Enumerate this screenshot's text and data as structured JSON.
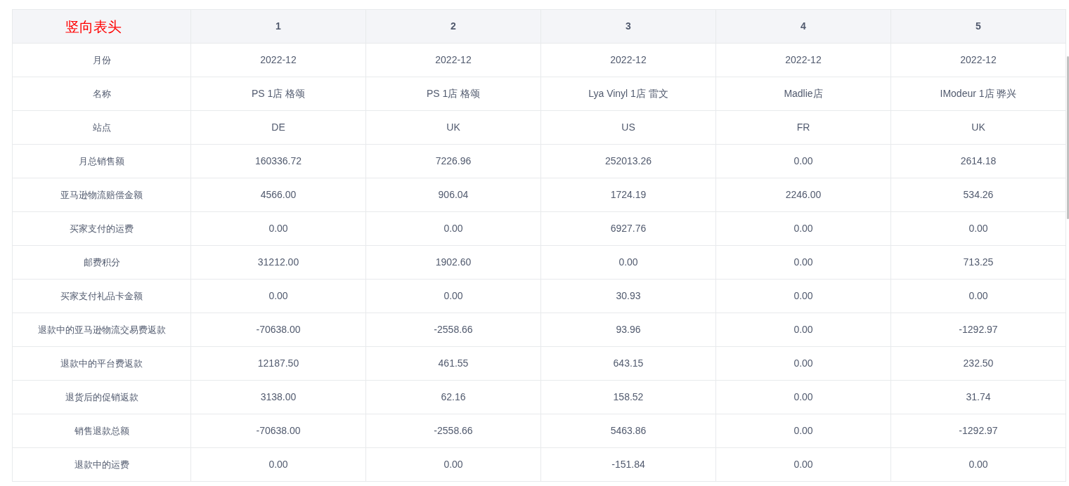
{
  "table": {
    "columns": [
      "竖向表头",
      "1",
      "2",
      "3",
      "4",
      "5"
    ],
    "rows": [
      {
        "cells": [
          "月份",
          "2022-12",
          "2022-12",
          "2022-12",
          "2022-12",
          "2022-12"
        ]
      },
      {
        "cells": [
          "名称",
          "PS 1店 格颂",
          "PS 1店 格颂",
          "Lya Vinyl 1店 雷文",
          "Madlie店",
          "IModeur 1店 骅兴"
        ]
      },
      {
        "cells": [
          "站点",
          "DE",
          "UK",
          "US",
          "FR",
          "UK"
        ]
      },
      {
        "cells": [
          "月总销售额",
          "160336.72",
          "7226.96",
          "252013.26",
          "0.00",
          "2614.18"
        ]
      },
      {
        "cells": [
          "亚马逊物流赔偿金额",
          "4566.00",
          "906.04",
          "1724.19",
          "2246.00",
          "534.26"
        ]
      },
      {
        "cells": [
          "买家支付的运费",
          "0.00",
          "0.00",
          "6927.76",
          "0.00",
          "0.00"
        ]
      },
      {
        "cells": [
          "邮费积分",
          "31212.00",
          "1902.60",
          "0.00",
          "0.00",
          "713.25"
        ]
      },
      {
        "cells": [
          "买家支付礼品卡金额",
          "0.00",
          "0.00",
          "30.93",
          "0.00",
          "0.00"
        ]
      },
      {
        "cells": [
          "退款中的亚马逊物流交易费返款",
          "-70638.00",
          "-2558.66",
          "93.96",
          "0.00",
          "-1292.97"
        ]
      },
      {
        "cells": [
          "退款中的平台费返款",
          "12187.50",
          "461.55",
          "643.15",
          "0.00",
          "232.50"
        ]
      },
      {
        "cells": [
          "退货后的促销返款",
          "3138.00",
          "62.16",
          "158.52",
          "0.00",
          "31.74"
        ]
      },
      {
        "cells": [
          "销售退款总额",
          "-70638.00",
          "-2558.66",
          "5463.86",
          "0.00",
          "-1292.97"
        ]
      },
      {
        "cells": [
          "退款中的运费",
          "0.00",
          "0.00",
          "-151.84",
          "0.00",
          "0.00"
        ]
      }
    ]
  }
}
